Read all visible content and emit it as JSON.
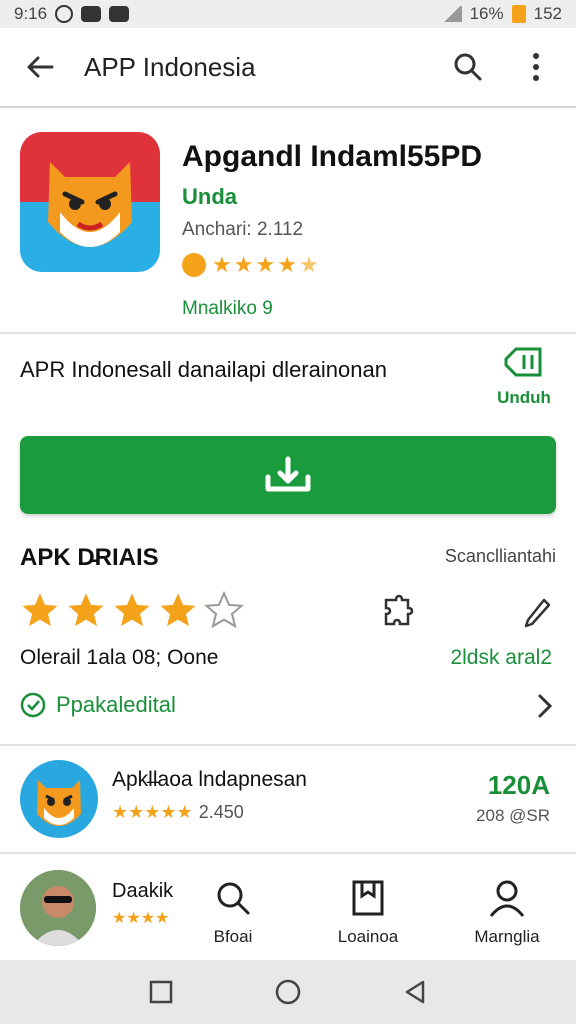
{
  "status_bar": {
    "time": "9:16",
    "battery": "16%",
    "extra": "152"
  },
  "app_bar": {
    "title": "APP Indonesia",
    "back_icon": "arrow-left-icon",
    "search_icon": "search-icon",
    "menu_icon": "more-vert-icon"
  },
  "app": {
    "name": "Apgandl Indaml55PD",
    "developer": "Unda",
    "version": "Anchari: 2.112",
    "installs": "Mnalkiko 9",
    "rating_stars": 4.5,
    "description": "APR Indonesall danailapi dlerainonan",
    "download_label": "Unduh"
  },
  "install_button": {
    "icon": "download-icon"
  },
  "details": {
    "title": "APK D̵RIAIS",
    "right_label": "Scanclliantahi",
    "stars": 4,
    "stars_max": 5,
    "info_text": "Olerail 1ala 08; Oone",
    "green_text": "2ldsk aral2",
    "verified_label": "Ppakaledital"
  },
  "recommended": {
    "name": "Apkl̶laoa lndapnesan",
    "rating": "2.450",
    "size": "120A",
    "sub": "208 @SR"
  },
  "bottom_nav": {
    "profile_name": "Daakik",
    "items": [
      {
        "label": "Bfoai",
        "icon": "search-icon"
      },
      {
        "label": "Loainoa",
        "icon": "bookmark-icon"
      },
      {
        "label": "Marnglia",
        "icon": "person-icon"
      }
    ]
  },
  "colors": {
    "accent": "#1a9c3e",
    "star": "#f3a21a",
    "green_text": "#1a8f3a"
  }
}
